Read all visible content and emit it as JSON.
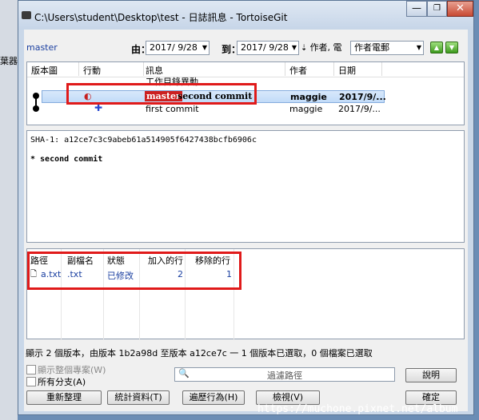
{
  "left_edge_text": "葉器",
  "window": {
    "title": "C:\\Users\\student\\Desktop\\test - 日誌訊息 - TortoiseGit",
    "min_glyph": "—",
    "max_glyph": "❐",
    "close_glyph": "✕"
  },
  "toolbar": {
    "branch": "master",
    "from_label": "由：",
    "from_date": "2017/ 9/28",
    "to_label": "到：",
    "to_date": "2017/ 9/28",
    "search_caption": "作者, 電",
    "filter_value": "作者電郵",
    "up_glyph": "▲",
    "down_glyph": "▼"
  },
  "log": {
    "columns": [
      "版本圖",
      "行動",
      "訊息",
      "作者",
      "日期"
    ],
    "rows": [
      {
        "message": "工作目錄異動",
        "author": "",
        "date": ""
      },
      {
        "tag": "master",
        "message": "second commit",
        "author": "maggie",
        "date": "2017/9/..."
      },
      {
        "message": "first commit",
        "author": "maggie",
        "date": "2017/9/..."
      }
    ]
  },
  "details": {
    "sha": "SHA-1: a12ce7c3c9abeb61a514905f6427438bcfb6906c",
    "message": "* second commit"
  },
  "files": {
    "columns": [
      "路徑",
      "副檔名",
      "狀態",
      "加入的行",
      "移除的行"
    ],
    "rows": [
      {
        "path": "a.txt",
        "ext": ".txt",
        "status": "已修改",
        "added": "2",
        "removed": "1"
      }
    ]
  },
  "status_line": "顯示 2 個版本，由版本 1b2a98d 至版本 a12ce7c 一 1 個版本已選取，0 個檔案已選取",
  "options": {
    "show_whole_project": "顯示整個專案(W)",
    "all_branches": "所有分支(A)"
  },
  "filter_path_placeholder": "過濾路徑",
  "buttons": {
    "help": "說明",
    "refresh": "重新整理",
    "statistics": "統計資料(T)",
    "walk": "遍歷行為(H)",
    "view": "檢視(V)",
    "ok": "確定"
  },
  "watermark": "https://muchone.pixnet.net/album"
}
